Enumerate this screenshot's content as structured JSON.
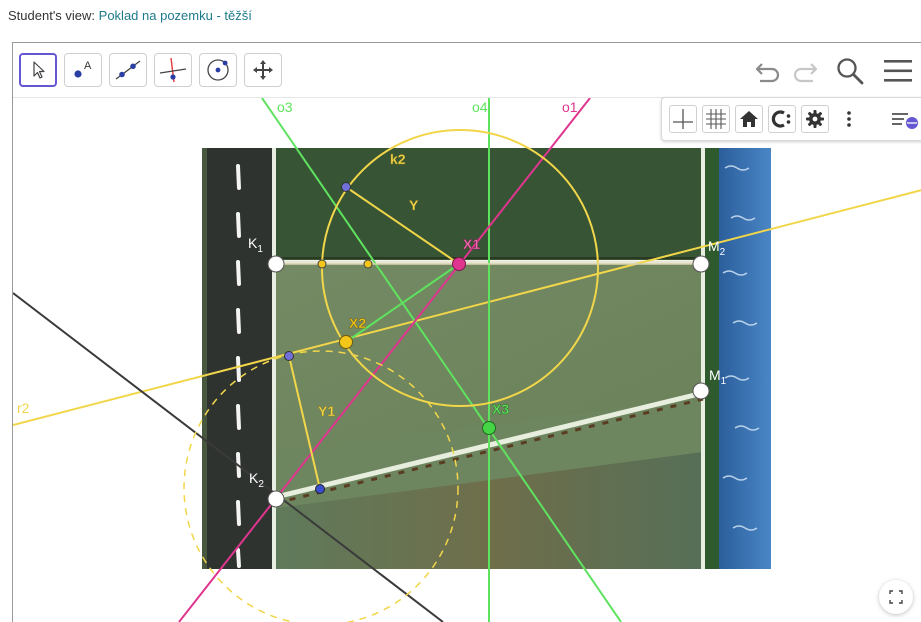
{
  "header": {
    "prefix": "Student's view:",
    "title": "Poklad na pozemku - těžší"
  },
  "toolbar": {
    "tools": [
      {
        "name": "move-tool",
        "icon": "arrow-cursor-icon",
        "active": true
      },
      {
        "name": "point-tool",
        "icon": "point-a-icon",
        "label": "A"
      },
      {
        "name": "line-tool",
        "icon": "line-icon"
      },
      {
        "name": "perpendicular-tool",
        "icon": "perpendicular-line-icon"
      },
      {
        "name": "circle-tool",
        "icon": "circle-center-icon"
      },
      {
        "name": "move-graphics-tool",
        "icon": "move-arrows-icon"
      }
    ],
    "right": [
      "undo-icon",
      "redo-icon",
      "search-icon",
      "menu-icon"
    ]
  },
  "stylebar": {
    "buttons": [
      "axes-icon",
      "grid-icon",
      "home-icon",
      "label-style-icon",
      "settings-icon",
      "more-icon",
      "style-bar-toggle-icon"
    ]
  },
  "labels": {
    "o3": "o3",
    "o4": "o4",
    "o1": "o1",
    "r2": "r2",
    "k2": "k2",
    "Y": "Y",
    "Y1": "Y1",
    "X1": "X1",
    "X2": "X2",
    "X3": "X3",
    "K": "K",
    "M": "M",
    "sub1": "1",
    "sub2": "2"
  },
  "colors": {
    "green_line": "#5fe35f",
    "magenta_line": "#e0358f",
    "yellow": "#f2d64a",
    "dark_line": "#3a3a3a",
    "header_link": "#1e7a8c",
    "active_tool_border": "#6557d2"
  }
}
